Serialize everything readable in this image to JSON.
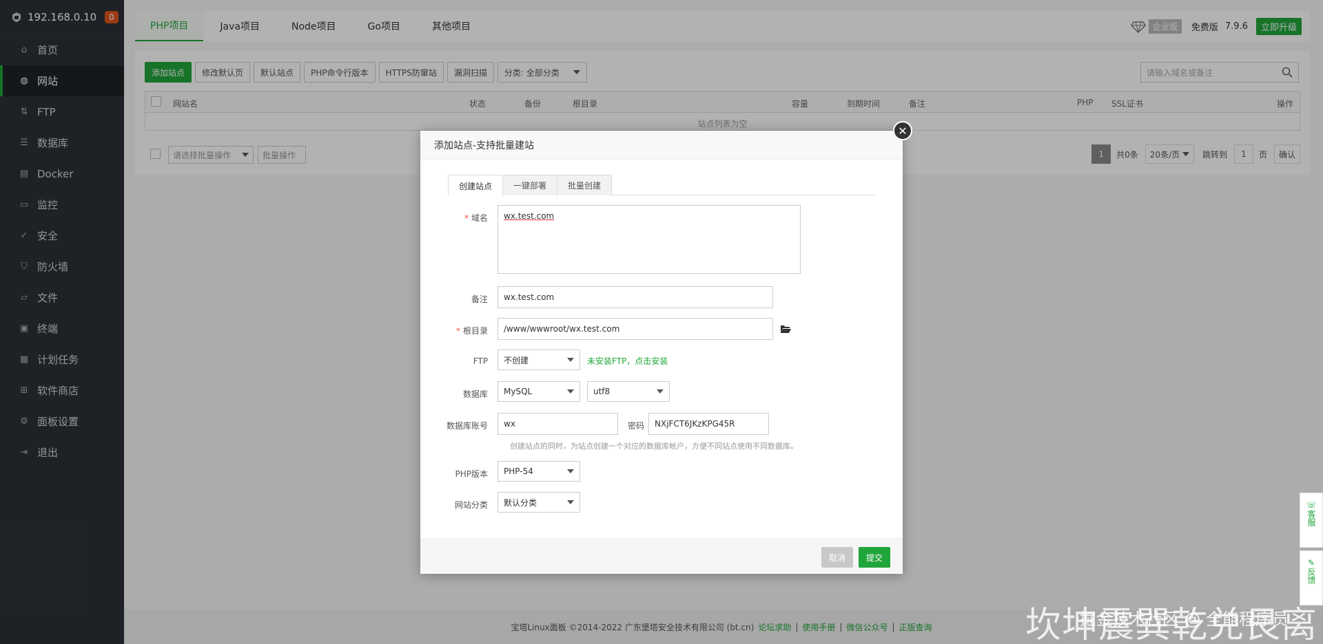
{
  "sidebar": {
    "host": "192.168.0.10",
    "badge": "0",
    "items": [
      {
        "label": "首页",
        "icon": "home-icon"
      },
      {
        "label": "网站",
        "icon": "globe-icon"
      },
      {
        "label": "FTP",
        "icon": "ftp-icon"
      },
      {
        "label": "数据库",
        "icon": "database-icon"
      },
      {
        "label": "Docker",
        "icon": "docker-icon"
      },
      {
        "label": "监控",
        "icon": "monitor-icon"
      },
      {
        "label": "安全",
        "icon": "shield-check-icon"
      },
      {
        "label": "防火墙",
        "icon": "shield-icon"
      },
      {
        "label": "文件",
        "icon": "folder-icon"
      },
      {
        "label": "终端",
        "icon": "terminal-icon"
      },
      {
        "label": "计划任务",
        "icon": "calendar-icon"
      },
      {
        "label": "软件商店",
        "icon": "apps-icon"
      },
      {
        "label": "面板设置",
        "icon": "gear-icon"
      },
      {
        "label": "退出",
        "icon": "logout-icon"
      }
    ]
  },
  "tabs": [
    "PHP项目",
    "Java项目",
    "Node项目",
    "Go项目",
    "其他项目"
  ],
  "topright": {
    "enterprise": "企业版",
    "free": "免费版",
    "version": "7.9.6",
    "upgrade": "立即升级"
  },
  "toolbar": {
    "add_site": "添加站点",
    "edit_default_page": "修改默认页",
    "default_site": "默认站点",
    "php_cli": "PHP命令行版本",
    "https_guard": "HTTPS防窜站",
    "vuln_scan": "漏洞扫描",
    "category": "分类: 全部分类"
  },
  "search": {
    "placeholder": "请输入域名或备注"
  },
  "table": {
    "headers": {
      "name": "网站名",
      "status": "状态",
      "backup": "备份",
      "root": "根目录",
      "capacity": "容量",
      "expire": "到期时间",
      "note": "备注",
      "php": "PHP",
      "ssl": "SSL证书",
      "ops": "操作"
    },
    "empty": "站点列表为空"
  },
  "bottom": {
    "batch_select": "请选择批量操作",
    "batch_btn": "批量操作",
    "page": "1",
    "total": "共0条",
    "per_page": "20条/页",
    "jump_to": "跳转到",
    "jump_value": "1",
    "page_unit": "页",
    "confirm": "确认"
  },
  "footer": {
    "copyright": "宝塔Linux面板 ©2014-2022 广东堡塔安全技术有限公司 (bt.cn)",
    "links": [
      "论坛求助",
      "使用手册",
      "微信公众号",
      "正版查询"
    ]
  },
  "float": {
    "service": "客服",
    "feedback": "反馈"
  },
  "modal": {
    "title": "添加站点-支持批量建站",
    "tabs": [
      "创建站点",
      "一键部署",
      "批量创建"
    ],
    "domain_label": "域名",
    "domain_value": "wx.test.com",
    "note_label": "备注",
    "note_value": "wx.test.com",
    "root_label": "根目录",
    "root_value": "/www/wwwroot/wx.test.com",
    "ftp_label": "FTP",
    "ftp_value": "不创建",
    "ftp_hint": "未安装FTP，点击安装",
    "db_label": "数据库",
    "db_value": "MySQL",
    "db_charset": "utf8",
    "db_account_label": "数据库账号",
    "db_account_value": "wx",
    "db_pwd_label": "密码",
    "db_pwd_value": "NXjFCT6JKzKPG45R",
    "db_hint": "创建站点的同时，为站点创建一个对应的数据库帐户，方便不同站点使用不同数据库。",
    "php_label": "PHP版本",
    "php_value": "PHP-54",
    "cat_label": "网站分类",
    "cat_value": "默认分类",
    "cancel": "取消",
    "submit": "提交"
  },
  "watermark": "坎坤震巽乾兑艮离",
  "watermark_sub": "掘金技术社区 @ 全能程序员",
  "colors": {
    "brand": "#20a53a",
    "sidebar": "#2c3138",
    "badge": "#e0541b"
  }
}
